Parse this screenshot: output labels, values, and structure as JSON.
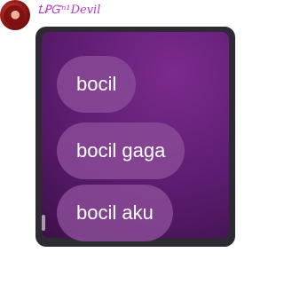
{
  "sender": {
    "name": "ꝈꝐᏳⁿ¹Devil"
  },
  "messages": [
    {
      "text": "bocil"
    },
    {
      "text": "bocil gaga"
    },
    {
      "text": "bocil aku"
    }
  ],
  "colors": {
    "sender_name": "#b03ec5",
    "bubble": "#8a4a96",
    "card_background": "#2e2a33"
  }
}
